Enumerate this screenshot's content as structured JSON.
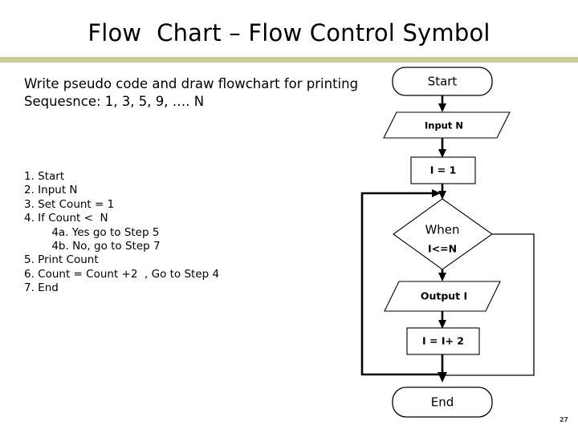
{
  "slide": {
    "title": "Flow  Chart – Flow Control Symbol",
    "page_number": "27",
    "rule_color": "#c9cc93",
    "background_color": "#ffffff",
    "text_color": "#000000"
  },
  "content": {
    "problem_statement": "Write pseudo code and draw flowchart for printing Sequesnce: 1, 3, 5, 9, …. N",
    "pseudo_code": [
      "1. Start",
      "2. Input N",
      "3. Set Count = 1",
      "4. If Count <  N",
      "        4a. Yes go to Step 5",
      "        4b. No, go to Step 7",
      "5. Print Count",
      "6. Count = Count +2  , Go to Step 4",
      "7. End"
    ]
  },
  "flowchart": {
    "nodes": [
      {
        "id": "start",
        "label": "Start",
        "shape": "terminator"
      },
      {
        "id": "input",
        "label": "Input N",
        "shape": "parallelogram"
      },
      {
        "id": "init",
        "label": "I = 1",
        "shape": "process"
      },
      {
        "id": "decide1",
        "label": "When",
        "shape": "decision"
      },
      {
        "id": "decide2",
        "label": "I<=N",
        "shape": "decision"
      },
      {
        "id": "output",
        "label": "Output I",
        "shape": "parallelogram"
      },
      {
        "id": "incr",
        "label": "I =  I+ 2",
        "shape": "process"
      },
      {
        "id": "end",
        "label": "End",
        "shape": "terminator"
      }
    ]
  }
}
